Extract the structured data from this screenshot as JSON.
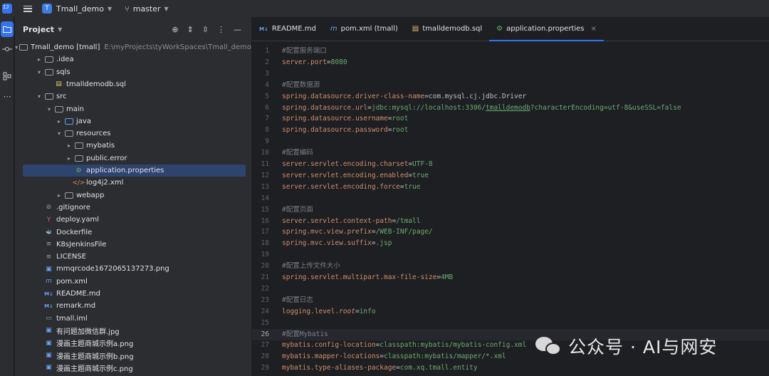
{
  "titlebar": {
    "project_badge": "T",
    "project_name": "Tmall_demo",
    "branch": "master"
  },
  "project_panel": {
    "title": "Project",
    "tree": [
      {
        "depth": 0,
        "arrow": "open",
        "icon": "folder",
        "label": "Tmall_demo [tmall]",
        "path": "E:\\myProjects\\tyWorkSpaces\\Tmall_demo"
      },
      {
        "depth": 1,
        "arrow": "closed",
        "icon": "folder",
        "label": ".idea"
      },
      {
        "depth": 1,
        "arrow": "open",
        "icon": "folder",
        "label": "sqls"
      },
      {
        "depth": 2,
        "arrow": "",
        "icon": "sql-file",
        "label": "tmalldemodb.sql"
      },
      {
        "depth": 1,
        "arrow": "open",
        "icon": "folder",
        "label": "src"
      },
      {
        "depth": 2,
        "arrow": "open",
        "icon": "folder",
        "label": "main"
      },
      {
        "depth": 3,
        "arrow": "closed",
        "icon": "folder-blue",
        "label": "java"
      },
      {
        "depth": 3,
        "arrow": "open",
        "icon": "folder",
        "label": "resources"
      },
      {
        "depth": 4,
        "arrow": "closed",
        "icon": "folder",
        "label": "mybatis"
      },
      {
        "depth": 4,
        "arrow": "closed",
        "icon": "folder",
        "label": "public.error"
      },
      {
        "depth": 4,
        "arrow": "",
        "icon": "properties-file",
        "label": "application.properties",
        "selected": true
      },
      {
        "depth": 4,
        "arrow": "",
        "icon": "xml-file",
        "label": "log4j2.xml"
      },
      {
        "depth": 3,
        "arrow": "closed",
        "icon": "folder",
        "label": "webapp"
      },
      {
        "depth": 1,
        "arrow": "",
        "icon": "gitignore-file",
        "label": ".gitignore"
      },
      {
        "depth": 1,
        "arrow": "",
        "icon": "yaml-file",
        "label": "deploy.yaml"
      },
      {
        "depth": 1,
        "arrow": "",
        "icon": "docker-file",
        "label": "Dockerfile"
      },
      {
        "depth": 1,
        "arrow": "",
        "icon": "text-file",
        "label": "K8sJenkinsFile"
      },
      {
        "depth": 1,
        "arrow": "",
        "icon": "text-file",
        "label": "LICENSE"
      },
      {
        "depth": 1,
        "arrow": "",
        "icon": "image-file",
        "label": "mmqrcode1672065137273.png"
      },
      {
        "depth": 1,
        "arrow": "",
        "icon": "maven-file",
        "label": "pom.xml"
      },
      {
        "depth": 1,
        "arrow": "",
        "icon": "markdown-file",
        "label": "README.md"
      },
      {
        "depth": 1,
        "arrow": "",
        "icon": "markdown-file",
        "label": "remark.md"
      },
      {
        "depth": 1,
        "arrow": "",
        "icon": "iml-file",
        "label": "tmall.iml"
      },
      {
        "depth": 1,
        "arrow": "",
        "icon": "image-file",
        "label": "有问题加微信群.jpg"
      },
      {
        "depth": 1,
        "arrow": "",
        "icon": "image-file",
        "label": "漫画主题商城示例a.png"
      },
      {
        "depth": 1,
        "arrow": "",
        "icon": "image-file",
        "label": "漫画主题商城示例b.png"
      },
      {
        "depth": 1,
        "arrow": "",
        "icon": "image-file",
        "label": "漫画主题商城示例c.png"
      }
    ]
  },
  "editor": {
    "tabs": [
      {
        "icon": "markdown-file",
        "icon_text": "M↓",
        "label": "README.md",
        "active": false
      },
      {
        "icon": "maven-file",
        "icon_text": "m",
        "label": "pom.xml (tmall)",
        "active": false
      },
      {
        "icon": "sql-file",
        "icon_text": "▤",
        "label": "tmalldemodb.sql",
        "active": false
      },
      {
        "icon": "properties-file",
        "icon_text": "⚙",
        "label": "application.properties",
        "active": true
      }
    ],
    "current_line": 26,
    "lines": [
      {
        "n": "1",
        "segs": [
          {
            "t": "#配置服务端口",
            "c": "c"
          }
        ]
      },
      {
        "n": "2",
        "segs": [
          {
            "t": "server.port",
            "c": "k"
          },
          {
            "t": "=",
            "c": "eq"
          },
          {
            "t": "8080",
            "c": "v"
          }
        ]
      },
      {
        "n": "3",
        "segs": []
      },
      {
        "n": "4",
        "segs": [
          {
            "t": "#配置数据源",
            "c": "c"
          }
        ]
      },
      {
        "n": "5",
        "segs": [
          {
            "t": "spring.datasource.driver-class-name",
            "c": "k"
          },
          {
            "t": "=",
            "c": "eq"
          },
          {
            "t": "com.mysql.cj.jdbc.Driver",
            "c": "eq"
          }
        ]
      },
      {
        "n": "6",
        "segs": [
          {
            "t": "spring.datasource.url",
            "c": "k"
          },
          {
            "t": "=",
            "c": "eq"
          },
          {
            "t": "jdbc:mysql://localhost:3306/",
            "c": "v"
          },
          {
            "t": "tmalldemodb",
            "c": "v-u"
          },
          {
            "t": "?characterEncoding=utf-8&useSSL=false",
            "c": "v"
          }
        ]
      },
      {
        "n": "7",
        "segs": [
          {
            "t": "spring.datasource.username",
            "c": "k"
          },
          {
            "t": "=",
            "c": "eq"
          },
          {
            "t": "root",
            "c": "v"
          }
        ]
      },
      {
        "n": "8",
        "segs": [
          {
            "t": "spring.datasource.password",
            "c": "k"
          },
          {
            "t": "=",
            "c": "eq"
          },
          {
            "t": "root",
            "c": "v"
          }
        ]
      },
      {
        "n": "9",
        "segs": []
      },
      {
        "n": "10",
        "segs": [
          {
            "t": "#配置编码",
            "c": "c"
          }
        ]
      },
      {
        "n": "11",
        "segs": [
          {
            "t": "server.servlet.encoding.charset",
            "c": "k"
          },
          {
            "t": "=",
            "c": "eq"
          },
          {
            "t": "UTF-8",
            "c": "v"
          }
        ]
      },
      {
        "n": "12",
        "segs": [
          {
            "t": "server.servlet.encoding.enabled",
            "c": "k"
          },
          {
            "t": "=",
            "c": "eq"
          },
          {
            "t": "true",
            "c": "v"
          }
        ]
      },
      {
        "n": "13",
        "segs": [
          {
            "t": "server.servlet.encoding.force",
            "c": "k"
          },
          {
            "t": "=",
            "c": "eq"
          },
          {
            "t": "true",
            "c": "v"
          }
        ]
      },
      {
        "n": "14",
        "segs": []
      },
      {
        "n": "15",
        "segs": [
          {
            "t": "#配置页面",
            "c": "c"
          }
        ]
      },
      {
        "n": "16",
        "segs": [
          {
            "t": "server.servlet.context-path",
            "c": "k"
          },
          {
            "t": "=",
            "c": "eq"
          },
          {
            "t": "/tmall",
            "c": "v"
          }
        ]
      },
      {
        "n": "17",
        "segs": [
          {
            "t": "spring.mvc.view.prefix",
            "c": "k"
          },
          {
            "t": "=",
            "c": "eq"
          },
          {
            "t": "/WEB-INF/page/",
            "c": "v"
          }
        ]
      },
      {
        "n": "18",
        "segs": [
          {
            "t": "spring.mvc.view.suffix",
            "c": "k"
          },
          {
            "t": "=",
            "c": "eq"
          },
          {
            "t": ".jsp",
            "c": "v"
          }
        ]
      },
      {
        "n": "19",
        "segs": []
      },
      {
        "n": "20",
        "segs": [
          {
            "t": "#配置上传文件大小",
            "c": "c"
          }
        ]
      },
      {
        "n": "21",
        "segs": [
          {
            "t": "spring.servlet.multipart.max-file-size",
            "c": "k"
          },
          {
            "t": "=",
            "c": "eq"
          },
          {
            "t": "4MB",
            "c": "v"
          }
        ]
      },
      {
        "n": "22",
        "segs": []
      },
      {
        "n": "23",
        "segs": [
          {
            "t": "#配置日志",
            "c": "c"
          }
        ]
      },
      {
        "n": "24",
        "segs": [
          {
            "t": "logging.level.",
            "c": "k"
          },
          {
            "t": "root",
            "c": "k it"
          },
          {
            "t": "=",
            "c": "eq"
          },
          {
            "t": "info",
            "c": "v"
          }
        ]
      },
      {
        "n": "25",
        "segs": []
      },
      {
        "n": "26",
        "segs": [
          {
            "t": "#配置Mybatis",
            "c": "c"
          }
        ]
      },
      {
        "n": "27",
        "segs": [
          {
            "t": "mybatis.config-location",
            "c": "k"
          },
          {
            "t": "=",
            "c": "eq"
          },
          {
            "t": "classpath:mybatis/mybatis-config.xml",
            "c": "v"
          }
        ]
      },
      {
        "n": "28",
        "segs": [
          {
            "t": "mybatis.mapper-locations",
            "c": "k"
          },
          {
            "t": "=",
            "c": "eq"
          },
          {
            "t": "classpath:mybatis/mapper/*.xml",
            "c": "v"
          }
        ]
      },
      {
        "n": "29",
        "segs": [
          {
            "t": "mybatis.type-aliases-package",
            "c": "k"
          },
          {
            "t": "=",
            "c": "eq"
          },
          {
            "t": "com.xq.tmall.entity",
            "c": "v"
          }
        ]
      }
    ]
  },
  "watermark": {
    "text": "公众号 · AI与网安"
  },
  "colors": {
    "accent": "#3574f0",
    "selection": "#2e436e",
    "key": "#cf8e6d",
    "value": "#6aab73",
    "comment": "#7a7e85"
  }
}
